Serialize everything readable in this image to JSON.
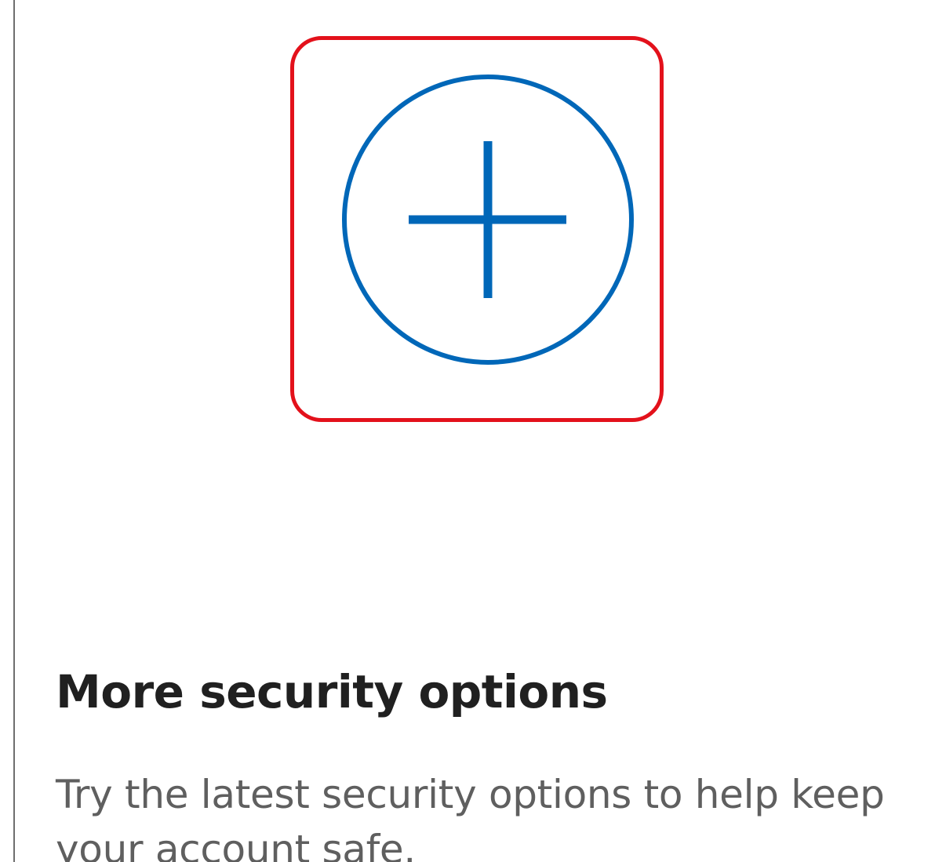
{
  "security_card": {
    "icon": "add-circle-icon",
    "title": "More security options",
    "description": "Try the latest security options to help keep your account safe."
  },
  "colors": {
    "icon_blue": "#0067b8",
    "highlight_red": "#e3111b",
    "title_text": "#202020",
    "description_text": "#5f5f5f"
  }
}
